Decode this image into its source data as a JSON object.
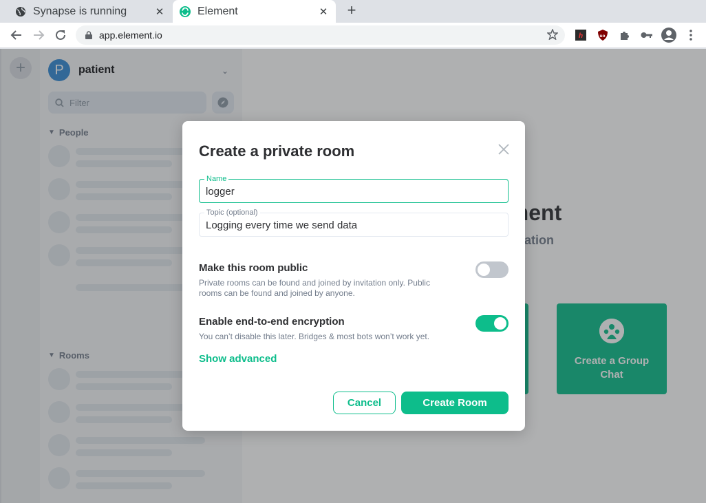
{
  "browser": {
    "tabs": [
      {
        "title": "Synapse is running",
        "favicon": "globe-icon",
        "active": false
      },
      {
        "title": "Element",
        "favicon": "element-logo-icon",
        "active": true
      }
    ],
    "url": "app.element.io"
  },
  "sidebar": {
    "user_initial": "P",
    "username": "patient",
    "filter_placeholder": "Filter",
    "sections": {
      "people": "People",
      "rooms": "Rooms"
    }
  },
  "welcome": {
    "title_fragment": "ement",
    "subtitle_fragment": "cation",
    "card_group_chat": "Create a Group Chat"
  },
  "dialog": {
    "title": "Create a private room",
    "name_label": "Name",
    "name_value": "logger",
    "topic_label": "Topic (optional)",
    "topic_value": "Logging every time we send data",
    "public_title": "Make this room public",
    "public_desc": "Private rooms can be found and joined by invitation only. Public rooms can be found and joined by anyone.",
    "public_enabled": false,
    "e2e_title": "Enable end-to-end encryption",
    "e2e_desc": "You can’t disable this later. Bridges & most bots won’t work yet.",
    "e2e_enabled": true,
    "show_advanced": "Show advanced",
    "cancel": "Cancel",
    "create": "Create Room"
  },
  "colors": {
    "accent": "#0dbd8b",
    "avatar": "#368bd6"
  }
}
